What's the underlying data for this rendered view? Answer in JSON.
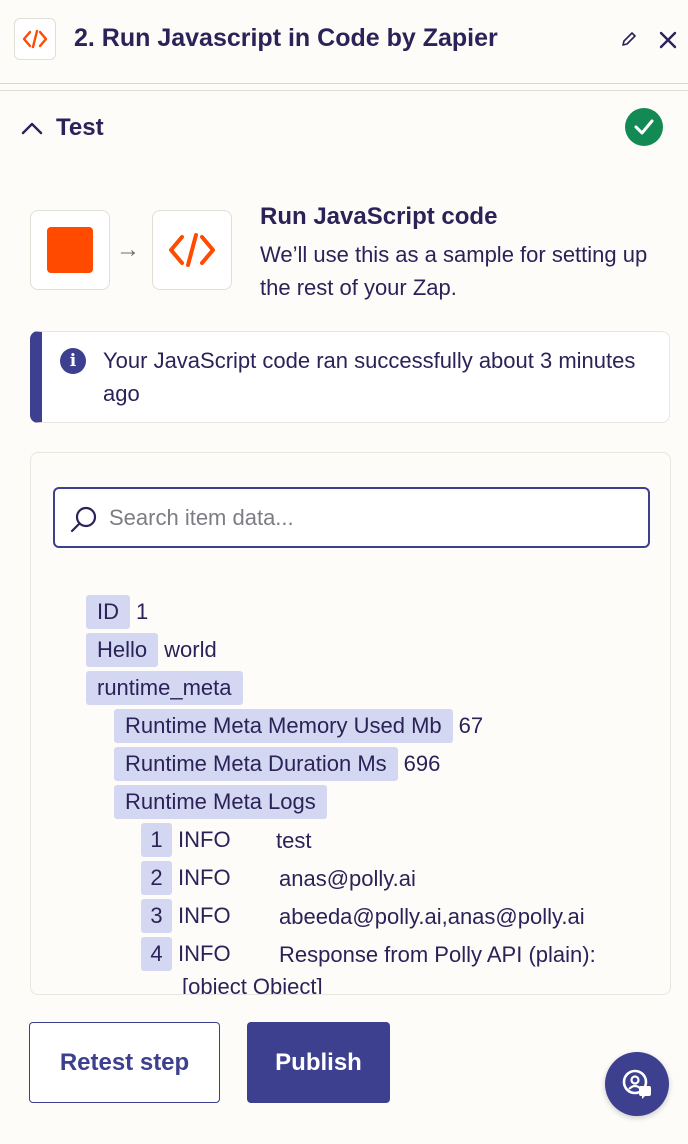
{
  "header": {
    "title": "2. Run Javascript in Code by Zapier",
    "app_icon": "code-brackets-icon",
    "edit_icon": "pencil-icon",
    "close_icon": "close-icon"
  },
  "test_section": {
    "title": "Test",
    "toggle_icon": "chevron-up-icon",
    "status_icon": "check-circle-icon"
  },
  "step_summary": {
    "title": "Run JavaScript code",
    "description": "We’ll use this as a sample for setting up the rest of your Zap.",
    "trigger_icon": "orange-square-icon",
    "action_icon": "code-brackets-icon"
  },
  "banner": {
    "message": "Your JavaScript code ran successfully about 3 minutes ago",
    "icon": "info-icon"
  },
  "data_panel": {
    "search_placeholder": "Search item data...",
    "fields": [
      {
        "key": "ID",
        "value": "1"
      },
      {
        "key": "Hello",
        "value": "world"
      },
      {
        "key": "runtime_meta",
        "value": ""
      }
    ],
    "runtime_meta": [
      {
        "key": "Runtime Meta Memory Used Mb",
        "value": "67"
      },
      {
        "key": "Runtime Meta Duration Ms",
        "value": "696"
      },
      {
        "key": "Runtime Meta Logs",
        "value": ""
      }
    ],
    "logs": [
      {
        "index": "1",
        "level": "INFO",
        "message": "test"
      },
      {
        "index": "2",
        "level": "INFO",
        "message": "anas@polly.ai"
      },
      {
        "index": "3",
        "level": "INFO",
        "message": "abeeda@polly.ai,anas@polly.ai"
      },
      {
        "index": "4",
        "level": "INFO",
        "message": "Response from Polly API (plain):",
        "continuation": "[object Object]"
      }
    ]
  },
  "footer": {
    "retest_label": "Retest step",
    "publish_label": "Publish",
    "help_icon": "help-chat-icon"
  },
  "colors": {
    "primary": "#3d3f8f",
    "zapier_orange": "#ff4a00",
    "success": "#138a53",
    "key_highlight": "#d3d7f2"
  }
}
